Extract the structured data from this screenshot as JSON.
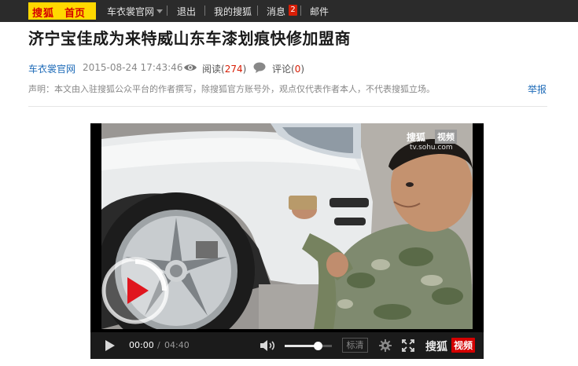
{
  "topbar": {
    "logo_brand": "搜狐",
    "logo_home": "首页",
    "account": "车衣裳官网",
    "logout": "退出",
    "my_sohu": "我的搜狐",
    "messages": "消息",
    "message_count": "2",
    "mail": "邮件"
  },
  "article": {
    "title": "济宁宝佳成为来特威山东车漆划痕快修加盟商",
    "author": "车衣裳官网",
    "datetime": "2015-08-24 17:43:46",
    "read_label": "阅读",
    "read_open": "(",
    "read_count": "274",
    "read_close": ")",
    "comment_label": "评论",
    "comment_open": "(",
    "comment_count": "0",
    "comment_close": ")",
    "statement": "声明：本文由入驻搜狐公众平台的作者撰写，除搜狐官方账号外，观点仅代表作者本人，不代表搜狐立场。",
    "report": "举报"
  },
  "video": {
    "watermark_brand": "搜狐",
    "watermark_tag": "视频",
    "watermark_url": "tv.sohu.com",
    "current_time": "00:00",
    "time_separator": "/",
    "total_time": "04:40",
    "volume_level": 0.7,
    "quality_label": "标清",
    "player_brand": "搜狐",
    "player_tag": "视频"
  },
  "colors": {
    "topbar_bg": "#2b2b2b",
    "logo_bg": "#ffd800",
    "brand_red": "#d40000",
    "link_blue": "#1e6bb8",
    "count_red": "#d81e06"
  },
  "icons": [
    "caret-down-icon",
    "eye-icon",
    "comment-icon",
    "play-icon",
    "volume-icon",
    "gear-icon",
    "fullscreen-icon",
    "play-overlay-icon"
  ]
}
